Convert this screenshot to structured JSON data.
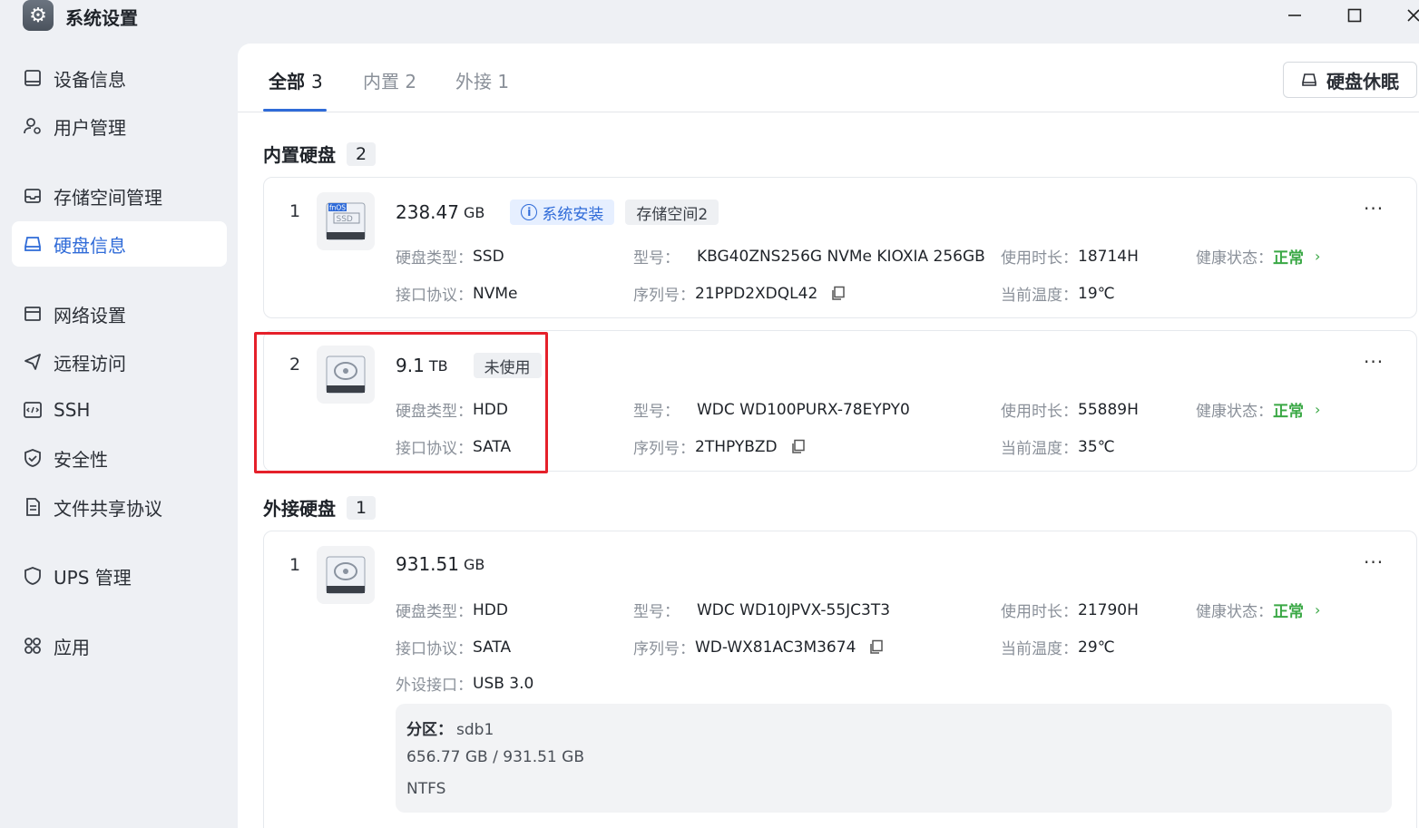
{
  "window": {
    "title": "系统设置",
    "app_icon": "gear-icon",
    "minimize": "—",
    "maximize": "☐",
    "close": "✕"
  },
  "sidebar": {
    "items": [
      {
        "label": "设备信息",
        "icon": "device-icon"
      },
      {
        "label": "用户管理",
        "icon": "user-gear-icon"
      },
      {
        "label": "存储空间管理",
        "icon": "storage-icon"
      },
      {
        "label": "硬盘信息",
        "icon": "disk-icon",
        "active": true
      },
      {
        "label": "网络设置",
        "icon": "network-icon"
      },
      {
        "label": "远程访问",
        "icon": "send-icon"
      },
      {
        "label": "SSH",
        "icon": "code-icon"
      },
      {
        "label": "安全性",
        "icon": "shield-check-icon"
      },
      {
        "label": "文件共享协议",
        "icon": "document-icon"
      },
      {
        "label": "UPS 管理",
        "icon": "shield-icon"
      },
      {
        "label": "应用",
        "icon": "apps-icon"
      }
    ]
  },
  "tabs": [
    {
      "label": "全部",
      "count": "3",
      "active": true
    },
    {
      "label": "内置",
      "count": "2"
    },
    {
      "label": "外接",
      "count": "1"
    }
  ],
  "sleep_button": "硬盘休眠",
  "internal": {
    "title": "内置硬盘",
    "count": "2",
    "disks": [
      {
        "index": "1",
        "size": "238.47",
        "unit": "GB",
        "image_label": "SSD",
        "image_brand": "fnOS",
        "tags": [
          "系统安装",
          "存储空间2"
        ],
        "type_label": "硬盘类型：",
        "type": "SSD",
        "iface_label": "接口协议：",
        "iface": "NVMe",
        "model_label": "型号：",
        "model": "KBG40ZNS256G NVMe KIOXIA 256GB",
        "serial_label": "序列号：",
        "serial": "21PPD2XDQL42",
        "hours_label": "使用时长：",
        "hours": "18714H",
        "temp_label": "当前温度：",
        "temp": "19℃",
        "health_label": "健康状态：",
        "health": "正常"
      },
      {
        "index": "2",
        "size": "9.1",
        "unit": "TB",
        "tags": [
          "未使用"
        ],
        "type_label": "硬盘类型：",
        "type": "HDD",
        "iface_label": "接口协议：",
        "iface": "SATA",
        "model_label": "型号：",
        "model": "WDC WD100PURX-78EYPY0",
        "serial_label": "序列号：",
        "serial": "2THPYBZD",
        "hours_label": "使用时长：",
        "hours": "55889H",
        "temp_label": "当前温度：",
        "temp": "35℃",
        "health_label": "健康状态：",
        "health": "正常"
      }
    ]
  },
  "external": {
    "title": "外接硬盘",
    "count": "1",
    "disks": [
      {
        "index": "1",
        "size": "931.51",
        "unit": "GB",
        "type_label": "硬盘类型：",
        "type": "HDD",
        "iface_label": "接口协议：",
        "iface": "SATA",
        "port_label": "外设接口：",
        "port": "USB 3.0",
        "model_label": "型号：",
        "model": "WDC WD10JPVX-55JC3T3",
        "serial_label": "序列号：",
        "serial": "WD-WX81AC3M3674",
        "hours_label": "使用时长：",
        "hours": "21790H",
        "temp_label": "当前温度：",
        "temp": "29℃",
        "health_label": "健康状态：",
        "health": "正常",
        "partition": {
          "label": "分区：",
          "name": "sdb1",
          "usage": "656.77 GB / 931.51 GB",
          "fs": "NTFS"
        }
      }
    ]
  },
  "more_label": "···",
  "chevron": "›",
  "colors": {
    "accent": "#2f6bd8",
    "ok": "#3aa845",
    "highlight": "#e5202a"
  }
}
